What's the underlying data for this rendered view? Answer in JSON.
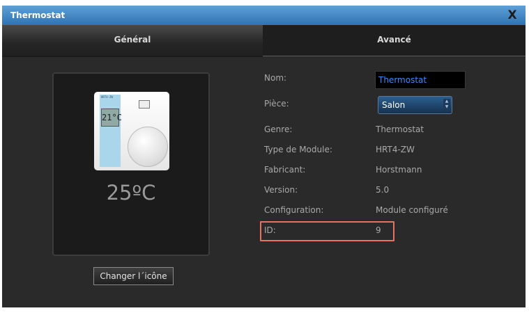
{
  "window": {
    "title": "Thermostat",
    "close_label": "X"
  },
  "tabs": [
    {
      "label": "Général",
      "active": true
    },
    {
      "label": "Avancé",
      "active": false
    }
  ],
  "device": {
    "model_text": "HRT4-ZW",
    "screen_text": "21°C",
    "temperature": "25ºC",
    "change_icon_label": "Changer l´icône"
  },
  "fields": {
    "name": {
      "label": "Nom:",
      "value": "Thermostat"
    },
    "room": {
      "label": "Pièce:",
      "value": "Salon"
    },
    "genre": {
      "label": "Genre:",
      "value": "Thermostat"
    },
    "module_type": {
      "label": "Type de Module:",
      "value": "HRT4-ZW"
    },
    "manufacturer": {
      "label": "Fabricant:",
      "value": "Horstmann"
    },
    "version": {
      "label": "Version:",
      "value": "5.0"
    },
    "configuration": {
      "label": "Configuration:",
      "value": "Module configuré"
    },
    "id": {
      "label": "ID:",
      "value": "9"
    }
  },
  "colors": {
    "titlebar": "#2f73b4",
    "input_text": "#3b8bff",
    "highlight": "#e8745f"
  }
}
